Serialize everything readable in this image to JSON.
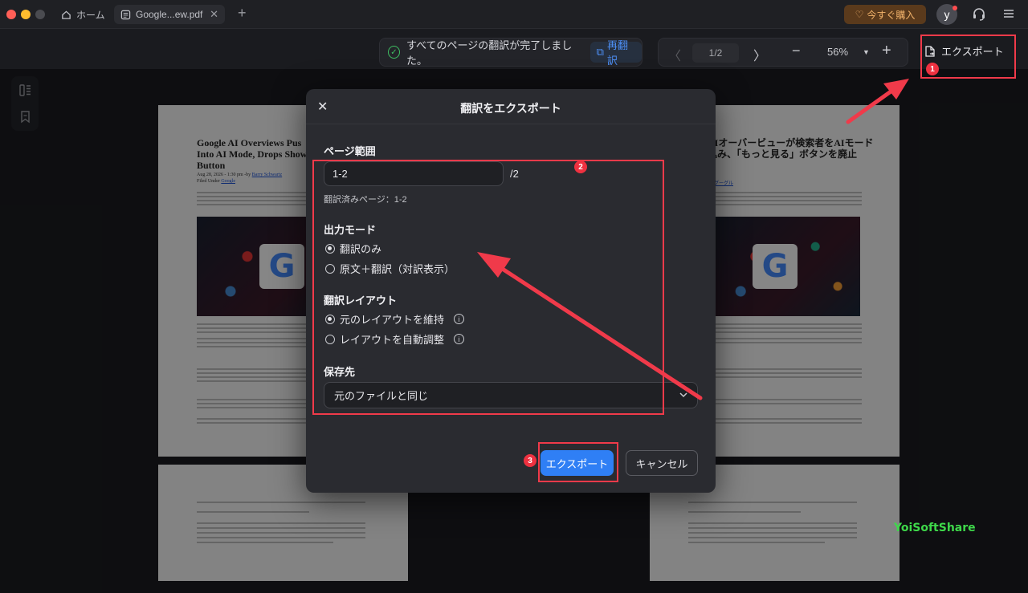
{
  "titlebar": {
    "tabs": [
      {
        "label": "ホーム",
        "icon": "home-icon"
      },
      {
        "label": "Google...ew.pdf",
        "icon": "pdf-icon"
      }
    ],
    "buy_label": "今すぐ購入",
    "avatar_letter": "y"
  },
  "toolbar": {
    "status_text": "すべてのページの翻訳が完了しました。",
    "retranslate_label": "再翻訳",
    "page_indicator": "1/2",
    "zoom": "56%",
    "export_label": "エクスポート"
  },
  "document": {
    "left_title": "Google AI Overviews Pus\nInto AI Mode, Drops Show\nButton",
    "left_meta": "Aug 28, 2026 - 1:30 pm -by",
    "left_author": "Barry Schwartz",
    "left_filed": "Filed Under",
    "left_filed_link": "Google",
    "right_title": "AIオーバービューが検索者をAIモード\n込み、「もっと見る」ボタンを廃止",
    "right_filed_link": "グーグル"
  },
  "dialog": {
    "title": "翻訳をエクスポート",
    "page_range_label": "ページ範囲",
    "page_range_value": "1-2",
    "page_total": "/2",
    "translated_pages": "翻訳済みページ：1-2",
    "output_mode_label": "出力モード",
    "output_options": [
      {
        "label": "翻訳のみ",
        "selected": true
      },
      {
        "label": "原文＋翻訳（対訳表示）",
        "selected": false
      }
    ],
    "layout_label": "翻訳レイアウト",
    "layout_options": [
      {
        "label": "元のレイアウトを維持",
        "selected": true
      },
      {
        "label": "レイアウトを自動調整",
        "selected": false
      }
    ],
    "save_label": "保存先",
    "save_value": "元のファイルと同じ",
    "export_button": "エクスポート",
    "cancel_button": "キャンセル"
  },
  "annotations": {
    "badge1": "1",
    "badge2": "2",
    "badge3": "3",
    "accent_color": "#f03a4a"
  },
  "watermark": "YoiSoftShare"
}
